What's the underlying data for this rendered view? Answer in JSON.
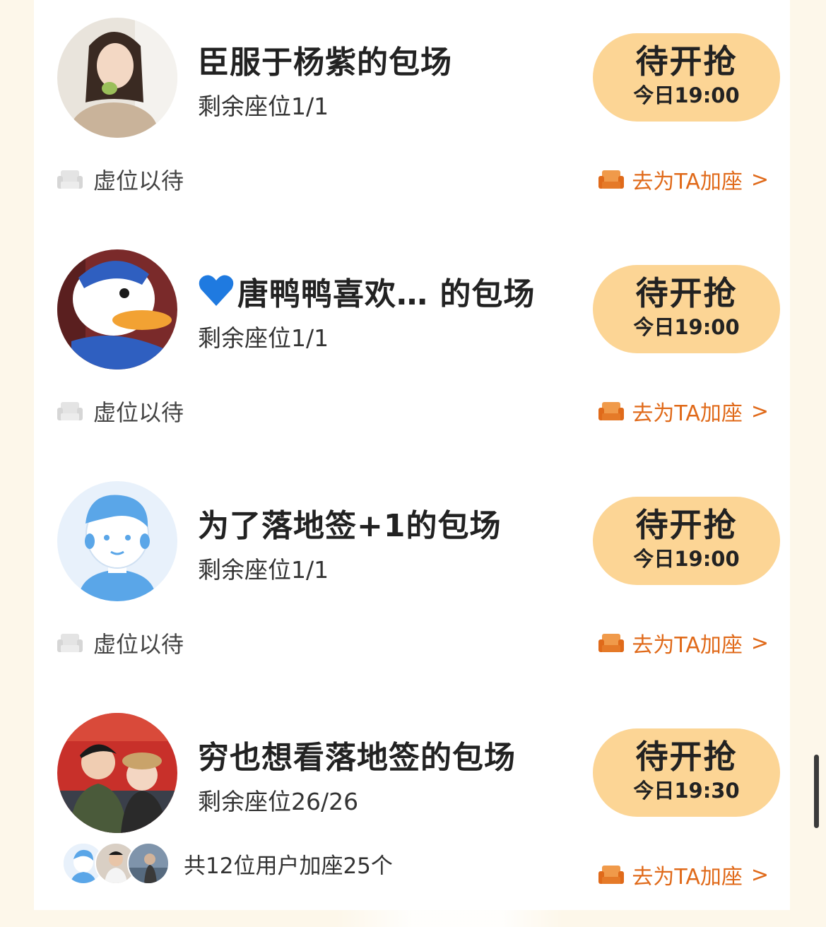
{
  "sessions": [
    {
      "title": "臣服于杨紫的包场",
      "seats": "剩余座位1/1",
      "button_main": "待开抢",
      "button_time": "今日19:00",
      "vacant_label": "虚位以待",
      "add_seat_label": "去为TA加座",
      "chevron": ">"
    },
    {
      "title": "唐鸭鸭喜欢…  的包场",
      "seats": "剩余座位1/1",
      "button_main": "待开抢",
      "button_time": "今日19:00",
      "vacant_label": "虚位以待",
      "add_seat_label": "去为TA加座",
      "chevron": ">"
    },
    {
      "title": "为了落地签+1的包场",
      "seats": "剩余座位1/1",
      "button_main": "待开抢",
      "button_time": "今日19:00",
      "vacant_label": "虚位以待",
      "add_seat_label": "去为TA加座",
      "chevron": ">"
    },
    {
      "title": "穷也想看落地签的包场",
      "seats": "剩余座位26/26",
      "button_main": "待开抢",
      "button_time": "今日19:30",
      "users_label": "共12位用户加座25个",
      "add_seat_label": "去为TA加座",
      "chevron": ">"
    }
  ],
  "icons": {
    "title_emoji": "blue-heart-icon",
    "vacant": "sofa-outline-icon",
    "add_seat": "sofa-icon"
  },
  "colors": {
    "button_bg": "#fcd595",
    "accent": "#e06a1a",
    "page_bg": "#fdf7ea"
  }
}
